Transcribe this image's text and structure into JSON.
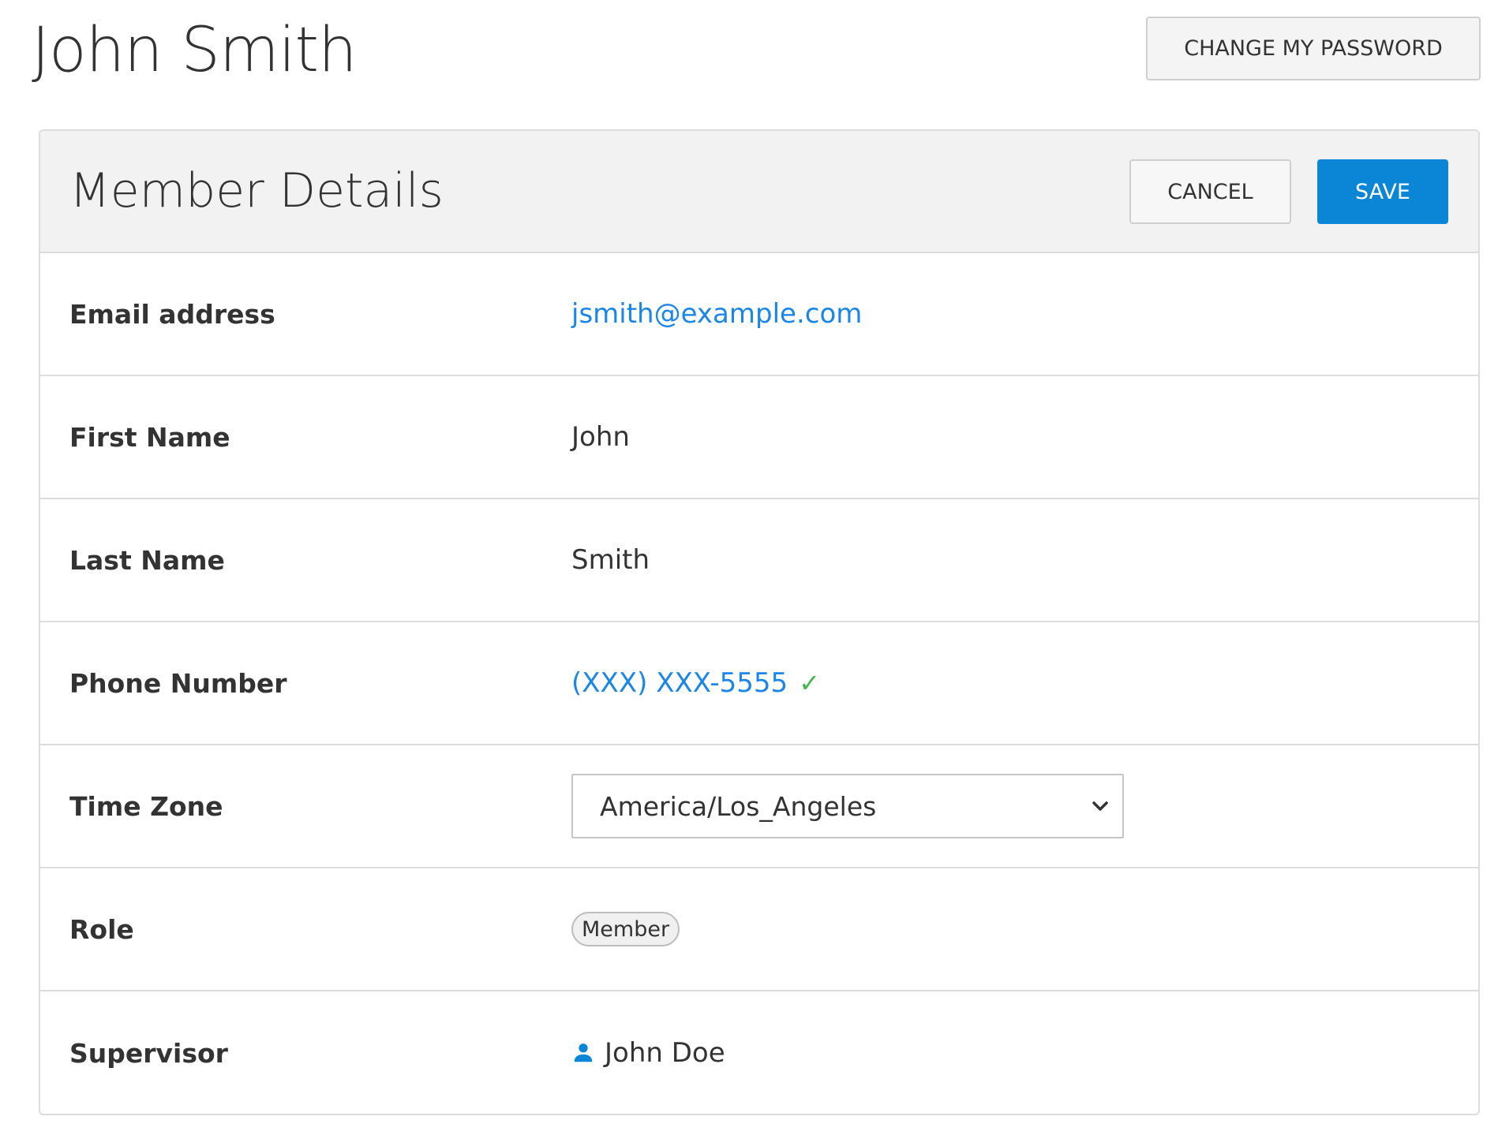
{
  "header": {
    "title": "John Smith",
    "change_password_label": "CHANGE MY PASSWORD"
  },
  "panel": {
    "title": "Member Details",
    "cancel_label": "CANCEL",
    "save_label": "SAVE"
  },
  "fields": {
    "email": {
      "label": "Email address",
      "value": "jsmith@example.com"
    },
    "first_name": {
      "label": "First Name",
      "value": "John"
    },
    "last_name": {
      "label": "Last Name",
      "value": "Smith"
    },
    "phone": {
      "label": "Phone Number",
      "value": "(XXX) XXX-5555",
      "verified_icon": "check-icon"
    },
    "time_zone": {
      "label": "Time Zone",
      "value": "America/Los_Angeles",
      "icon": "chevron-down-icon"
    },
    "role": {
      "label": "Role",
      "value": "Member"
    },
    "supervisor": {
      "label": "Supervisor",
      "value": "John Doe",
      "icon": "user-icon"
    }
  },
  "colors": {
    "primary": "#0b85d6",
    "link": "#1a86e8",
    "verified": "#3cb949",
    "panel_heading_bg": "#f2f2f2",
    "border": "#dddddd"
  }
}
